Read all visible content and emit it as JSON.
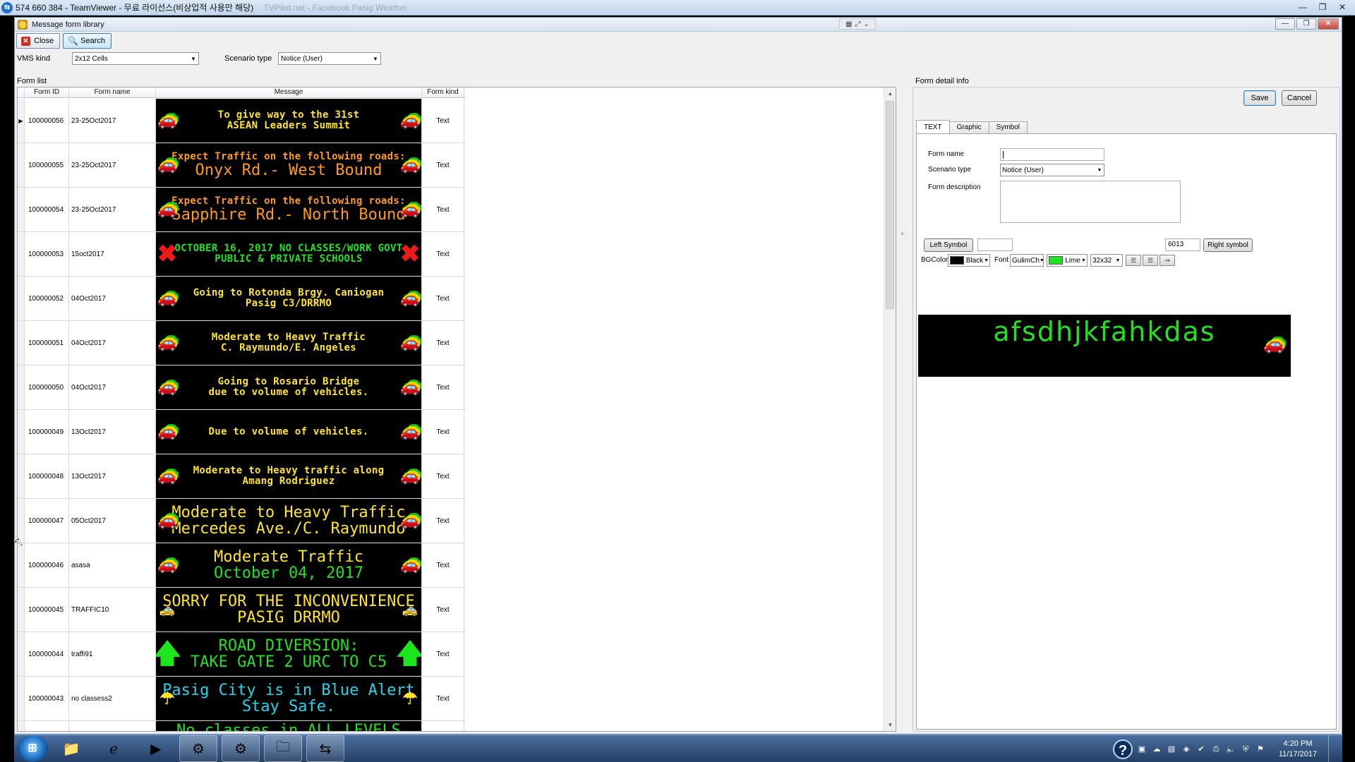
{
  "teamviewer": {
    "title": "574 660 384 - TeamViewer - 무료 라이선스(비상업적 사용만 해당)",
    "ghost_text": "TVPilot.net - Facebook  Pasig Weather"
  },
  "window": {
    "title": "Message form library"
  },
  "toolbar": {
    "close_label": "Close",
    "search_label": "Search"
  },
  "filters": {
    "vms_kind_label": "VMS kind",
    "vms_kind_value": "2x12 Cells",
    "scenario_label": "Scenario type",
    "scenario_value": "Notice (User)"
  },
  "form_list": {
    "label": "Form list",
    "columns": [
      "Form ID",
      "Form name",
      "Message",
      "Form kind"
    ],
    "rows": [
      {
        "id": "100000056",
        "name": "23-25Oct2017",
        "kind": "Text",
        "size": "sm",
        "lines": [
          {
            "text": "To give way to the 31st",
            "color": "#ffe42a"
          },
          {
            "text": "ASEAN Leaders Summit",
            "color": "#ffe42a"
          }
        ],
        "sym": "car",
        "selected": true
      },
      {
        "id": "100000055",
        "name": "23-25Oct2017",
        "kind": "Text",
        "size": "mix",
        "lines": [
          {
            "text": "Expect Traffic on the following roads:",
            "color": "#ff9a1a",
            "s": "sm"
          },
          {
            "text": "Onyx Rd.- West Bound",
            "color": "#ff9a1a",
            "s": "lg"
          }
        ],
        "sym": "car"
      },
      {
        "id": "100000054",
        "name": "23-25Oct2017",
        "kind": "Text",
        "size": "mix",
        "lines": [
          {
            "text": "Expect Traffic on the following roads:",
            "color": "#ff9a1a",
            "s": "sm"
          },
          {
            "text": "Sapphire Rd.- North Bound",
            "color": "#ff9a1a",
            "s": "lg"
          }
        ],
        "sym": "car"
      },
      {
        "id": "100000053",
        "name": "15oct2017",
        "kind": "Text",
        "size": "sm",
        "lines": [
          {
            "text": "OCTOBER 16, 2017 NO CLASSES/WORK GOVT",
            "color": "#22e022"
          },
          {
            "text": "PUBLIC & PRIVATE SCHOOLS",
            "color": "#22e022"
          }
        ],
        "sym": "cross"
      },
      {
        "id": "100000052",
        "name": "04Oct2017",
        "kind": "Text",
        "size": "sm",
        "lines": [
          {
            "text": "Going to Rotonda Brgy. Caniogan",
            "color": "#ffe42a"
          },
          {
            "text": "Pasig C3/DRRMO",
            "color": "#ffe42a"
          }
        ],
        "sym": "car"
      },
      {
        "id": "100000051",
        "name": "04Oct2017",
        "kind": "Text",
        "size": "sm",
        "lines": [
          {
            "text": "Moderate to Heavy Traffic",
            "color": "#ffe42a"
          },
          {
            "text": "C. Raymundo/E. Angeles",
            "color": "#ffe42a"
          }
        ],
        "sym": "car"
      },
      {
        "id": "100000050",
        "name": "04Oct2017",
        "kind": "Text",
        "size": "sm",
        "lines": [
          {
            "text": "Going to Rosario Bridge",
            "color": "#ffe42a"
          },
          {
            "text": "due to volume of vehicles.",
            "color": "#ffe42a"
          }
        ],
        "sym": "car"
      },
      {
        "id": "100000049",
        "name": "13Oct2017",
        "kind": "Text",
        "size": "sm",
        "lines": [
          {
            "text": "Due to volume of vehicles.",
            "color": "#ffe42a"
          }
        ],
        "sym": "car"
      },
      {
        "id": "100000048",
        "name": "13Oct2017",
        "kind": "Text",
        "size": "sm",
        "lines": [
          {
            "text": "Moderate to Heavy traffic along",
            "color": "#ffe42a"
          },
          {
            "text": "Amang Rodriguez",
            "color": "#ffe42a"
          }
        ],
        "sym": "car"
      },
      {
        "id": "100000047",
        "name": "05Oct2017",
        "kind": "Text",
        "size": "lg",
        "lines": [
          {
            "text": "Moderate to Heavy Traffic",
            "color": "#ffe42a"
          },
          {
            "text": "Mercedes Ave./C. Raymundo",
            "color": "#ffe42a"
          }
        ],
        "sym": "car"
      },
      {
        "id": "100000046",
        "name": "asasa",
        "kind": "Text",
        "size": "lg",
        "lines": [
          {
            "text": "Moderate Traffic",
            "color": "#ffe42a"
          },
          {
            "text": "October 04, 2017",
            "color": "#22e022"
          }
        ],
        "sym": "car"
      },
      {
        "id": "100000045",
        "name": "TRAFFIC10",
        "kind": "Text",
        "size": "lg",
        "lines": [
          {
            "text": "SORRY FOR THE INCONVENIENCE",
            "color": "#ffe42a"
          },
          {
            "text": "PASIG DRRMO",
            "color": "#ffe42a"
          }
        ],
        "sym": "yellowcar"
      },
      {
        "id": "100000044",
        "name": "traffi91",
        "kind": "Text",
        "size": "lg",
        "lines": [
          {
            "text": "ROAD DIVERSION:",
            "color": "#22e022"
          },
          {
            "text": "TAKE GATE 2 URC TO C5",
            "color": "#22e022"
          }
        ],
        "sym": "up"
      },
      {
        "id": "100000043",
        "name": "no classess2",
        "kind": "Text",
        "size": "lg",
        "lines": [
          {
            "text": "Pasig City is in Blue Alert",
            "color": "#20d6ee"
          },
          {
            "text": "Stay Safe.",
            "color": "#20d6ee"
          }
        ],
        "sym": "umbrella"
      },
      {
        "id": "",
        "name": "",
        "kind": "",
        "size": "lg",
        "lines": [
          {
            "text": "No classes in ALL LEVELS",
            "color": "#22e022"
          }
        ],
        "sym": "none"
      }
    ]
  },
  "detail": {
    "label": "Form detail info",
    "save_label": "Save",
    "cancel_label": "Cancel",
    "tabs": [
      "TEXT",
      "Graphic",
      "Symbol"
    ],
    "form_name_label": "Form name",
    "form_name_value": "",
    "scenario_label": "Scenario type",
    "scenario_value": "Notice (User)",
    "description_label": "Form description",
    "left_symbol_label": "Left Symbol",
    "left_symbol_value": "",
    "right_symbol_value": "6013",
    "right_symbol_label": "Right symbol",
    "bgcolor_label": "BGColor",
    "bgcolor_value": "Black",
    "bgcolor_hex": "#000000",
    "font_label": "Font",
    "font_value": "GulimCh",
    "text_color_value": "Lime",
    "text_color_hex": "#22e022",
    "size_value": "32x32",
    "preview_text": "afsdhjkfahkdas"
  },
  "taskbar": {
    "clock_time": "4:20 PM",
    "clock_date": "11/17/2017"
  }
}
